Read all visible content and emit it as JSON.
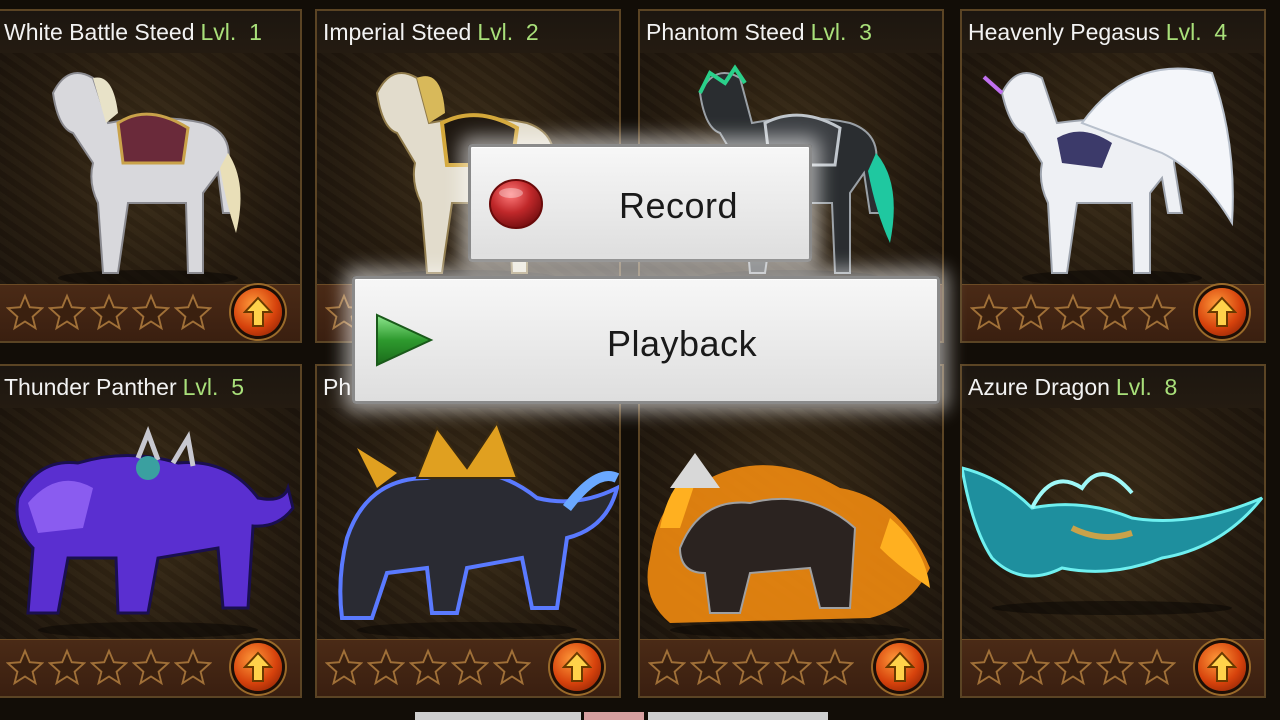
{
  "mounts": [
    {
      "name": "White Battle Steed",
      "level_label": "Lvl.",
      "level": "1",
      "stars": 5,
      "icon": "white-horse"
    },
    {
      "name": "Imperial Steed",
      "level_label": "Lvl.",
      "level": "2",
      "stars": 5,
      "icon": "gold-horse"
    },
    {
      "name": "Phantom Steed",
      "level_label": "Lvl.",
      "level": "3",
      "stars": 5,
      "icon": "phantom-horse"
    },
    {
      "name": "Heavenly Pegasus",
      "level_label": "Lvl.",
      "level": "4",
      "stars": 5,
      "icon": "pegasus"
    },
    {
      "name": "Thunder Panther",
      "level_label": "Lvl.",
      "level": "5",
      "stars": 5,
      "icon": "panther"
    },
    {
      "name": "Pha",
      "level_label": "",
      "level": "",
      "stars": 5,
      "icon": "dragon-beast"
    },
    {
      "name": "",
      "level_label": "",
      "level": "",
      "stars": 5,
      "icon": "flame-beast"
    },
    {
      "name": "Azure Dragon",
      "level_label": "Lvl.",
      "level": "8",
      "stars": 5,
      "icon": "azure-dragon"
    }
  ],
  "overlay": {
    "record_label": "Record",
    "playback_label": "Playback"
  },
  "colors": {
    "level_text": "#a9e07a",
    "card_border": "#5b4424",
    "upgrade_button": "#d6420c",
    "record_dot": "#c0282a",
    "playback_arrow": "#2e9a2e"
  }
}
